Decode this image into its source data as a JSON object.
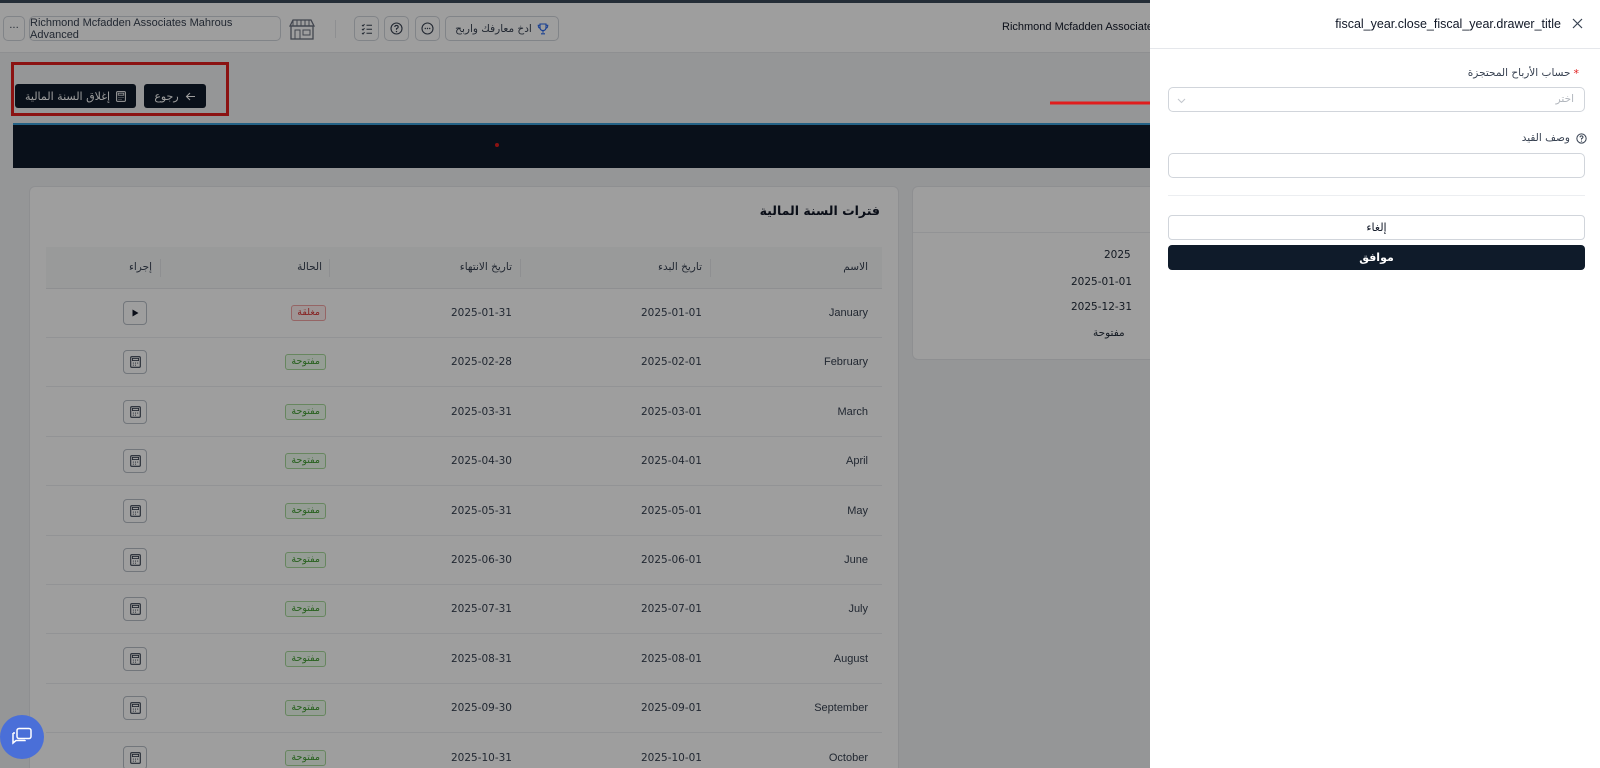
{
  "header": {
    "company_name": "Richmond Mcfadden Associates Mahrous Advanced",
    "company_name_right": "Richmond Mcfadden Associates",
    "more_label": "···",
    "challenge_label": "ادخ معارفك واربح"
  },
  "page": {
    "back_label": "رجوع",
    "close_year_label": "إغلاق السنة المالية"
  },
  "periods": {
    "title": "فترات السنة المالية",
    "columns": [
      "الاسم",
      "تاريخ البدء",
      "تاريخ الانتهاء",
      "الحالة",
      "إجراء"
    ],
    "rows": [
      {
        "name": "January",
        "start": "2025-01-01",
        "end": "2025-01-31",
        "status": "مغلقة",
        "state": "closed"
      },
      {
        "name": "February",
        "start": "2025-02-01",
        "end": "2025-02-28",
        "status": "مفتوحة",
        "state": "open"
      },
      {
        "name": "March",
        "start": "2025-03-01",
        "end": "2025-03-31",
        "status": "مفتوحة",
        "state": "open"
      },
      {
        "name": "April",
        "start": "2025-04-01",
        "end": "2025-04-30",
        "status": "مفتوحة",
        "state": "open"
      },
      {
        "name": "May",
        "start": "2025-05-01",
        "end": "2025-05-31",
        "status": "مفتوحة",
        "state": "open"
      },
      {
        "name": "June",
        "start": "2025-06-01",
        "end": "2025-06-30",
        "status": "مفتوحة",
        "state": "open"
      },
      {
        "name": "July",
        "start": "2025-07-01",
        "end": "2025-07-31",
        "status": "مفتوحة",
        "state": "open"
      },
      {
        "name": "August",
        "start": "2025-08-01",
        "end": "2025-08-31",
        "status": "مفتوحة",
        "state": "open"
      },
      {
        "name": "September",
        "start": "2025-09-01",
        "end": "2025-09-30",
        "status": "مفتوحة",
        "state": "open"
      },
      {
        "name": "October",
        "start": "2025-10-01",
        "end": "2025-10-31",
        "status": "مفتوحة",
        "state": "open"
      }
    ]
  },
  "year_info": {
    "year": "2025",
    "start": "2025-01-01",
    "end": "2025-12-31",
    "status": "مفتوحة"
  },
  "drawer": {
    "title": "fiscal_year.close_fiscal_year.drawer_title",
    "retained_label": "حساب الأرباح المحتجزة",
    "required_mark": "*",
    "retained_placeholder": "اختر",
    "description_label": "وصف القيد",
    "description_value": "",
    "cancel_label": "إلغاء",
    "ok_label": "موافق"
  },
  "colors": {
    "dark_navy": "#0f1b2a",
    "annotation_red": "#e11d1d",
    "open_green": "#3f9c2f",
    "closed_red": "#d93636",
    "chat_blue": "#4a6fd8"
  }
}
